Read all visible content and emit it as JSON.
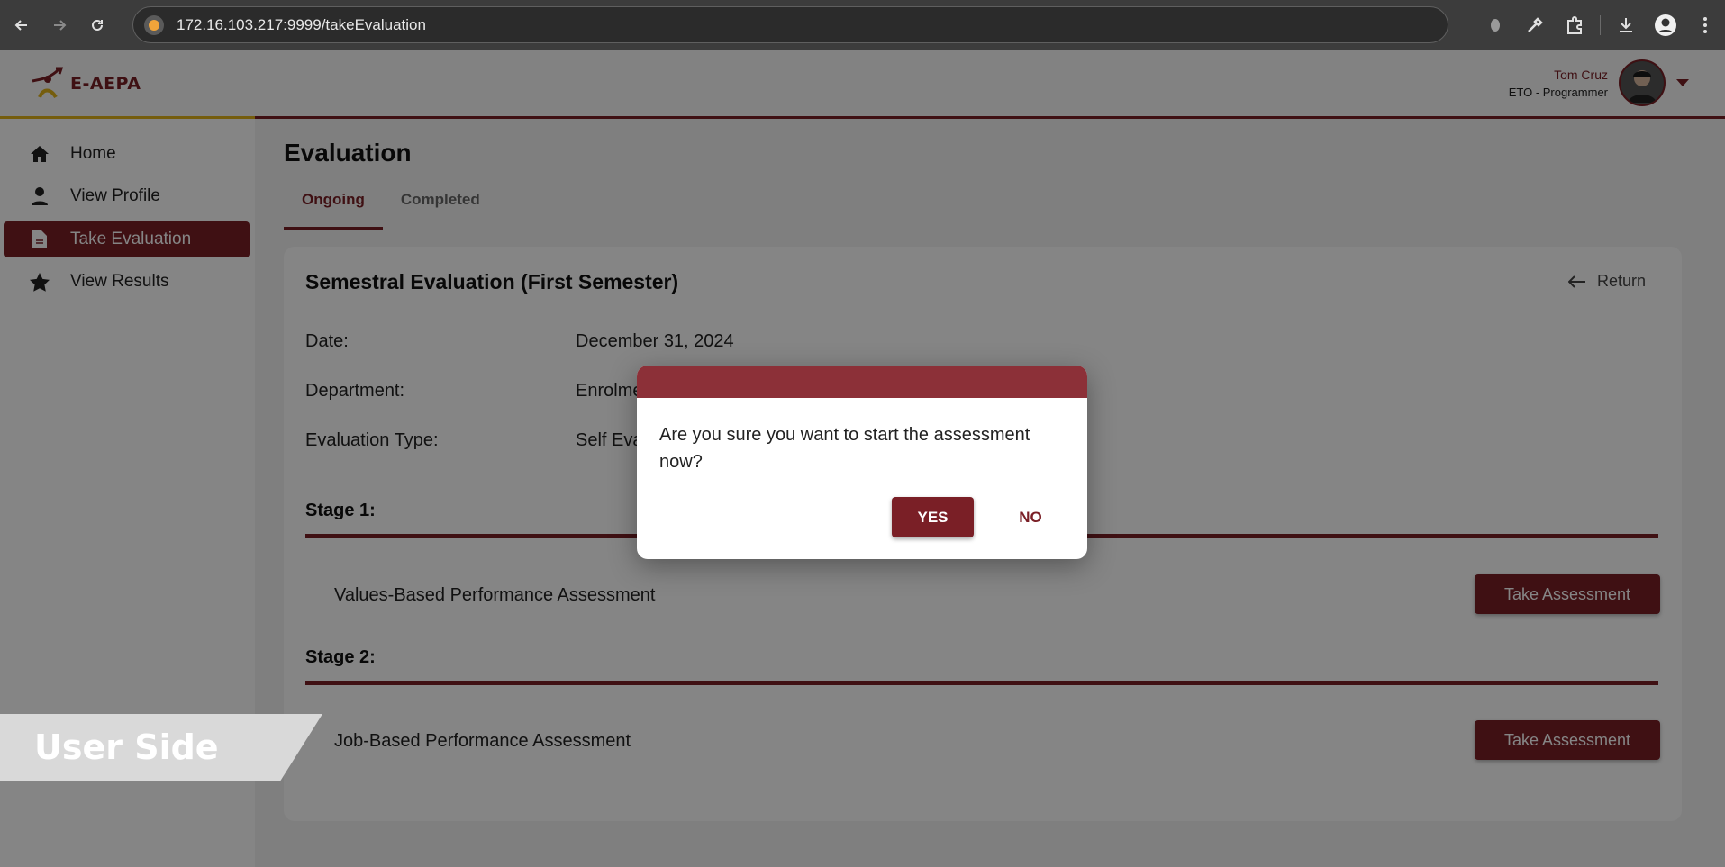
{
  "browser": {
    "url": "172.16.103.217:9999/takeEvaluation"
  },
  "header": {
    "logo_text": "E-AEPA",
    "user_name": "Tom Cruz",
    "user_role": "ETO - Programmer"
  },
  "sidebar": {
    "items": [
      {
        "label": "Home",
        "icon": "home-icon",
        "active": false
      },
      {
        "label": "View Profile",
        "icon": "user-icon",
        "active": false
      },
      {
        "label": "Take Evaluation",
        "icon": "document-icon",
        "active": true
      },
      {
        "label": "View Results",
        "icon": "star-icon",
        "active": false
      }
    ]
  },
  "main": {
    "title": "Evaluation",
    "tabs": [
      {
        "label": "Ongoing",
        "active": true
      },
      {
        "label": "Completed",
        "active": false
      }
    ],
    "card": {
      "title": "Semestral Evaluation (First Semester)",
      "return_label": "Return",
      "fields": [
        {
          "label": "Date:",
          "value": "December 31, 2024"
        },
        {
          "label": "Department:",
          "value": "Enrolment"
        },
        {
          "label": "Evaluation Type:",
          "value": "Self Evaluation"
        }
      ],
      "stages": [
        {
          "label": "Stage 1:",
          "assessment": "Values-Based Performance Assessment",
          "button": "Take Assessment"
        },
        {
          "label": "Stage 2:",
          "assessment": "Job-Based Performance Assessment",
          "button": "Take Assessment"
        }
      ]
    }
  },
  "dialog": {
    "message": "Are you sure you want to start the assessment now?",
    "yes_label": "YES",
    "no_label": "NO"
  },
  "banner": {
    "text": "User Side"
  },
  "colors": {
    "brand": "#7a1f26",
    "accent": "#e0b21a",
    "dialog_header": "#8c3038"
  }
}
